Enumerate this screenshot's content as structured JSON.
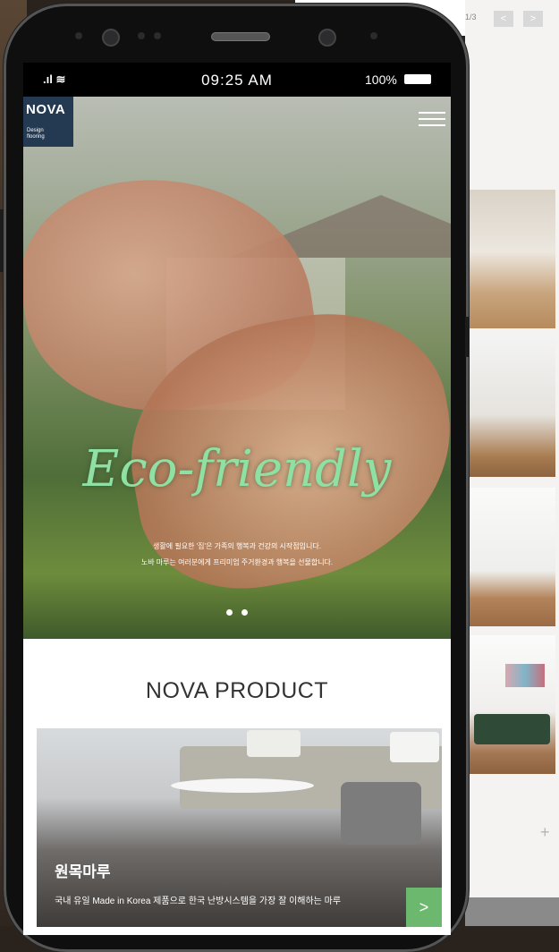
{
  "background": {
    "pager": "1/3",
    "prev_icon": "<",
    "next_icon": ">",
    "plus_icon": "+"
  },
  "status": {
    "signal": ".ıl ≋",
    "time": "09:25 AM",
    "battery": "100%"
  },
  "header": {
    "logo": "NOVA",
    "logo_sub_line1": "Design",
    "logo_sub_line2": "flooring",
    "menu_icon": "hamburger-icon"
  },
  "hero": {
    "script_title": "Eco-friendly",
    "tagline_line1": "생활에 필요한 '집'은 가족의 행복과 건강의 시작점입니다.",
    "tagline_line2": "노바 마루는 여러분에게 프리미엄 주거환경과 행복을 선물합니다.",
    "slide_count": 2,
    "active_slide": 1
  },
  "product": {
    "section_title": "NOVA PRODUCT",
    "card_name": "원목마루",
    "card_desc": "국내 유일 Made in Korea 제품으로 한국 난방시스템을 가장 잘 이해하는 마루",
    "card_arrow": ">"
  }
}
